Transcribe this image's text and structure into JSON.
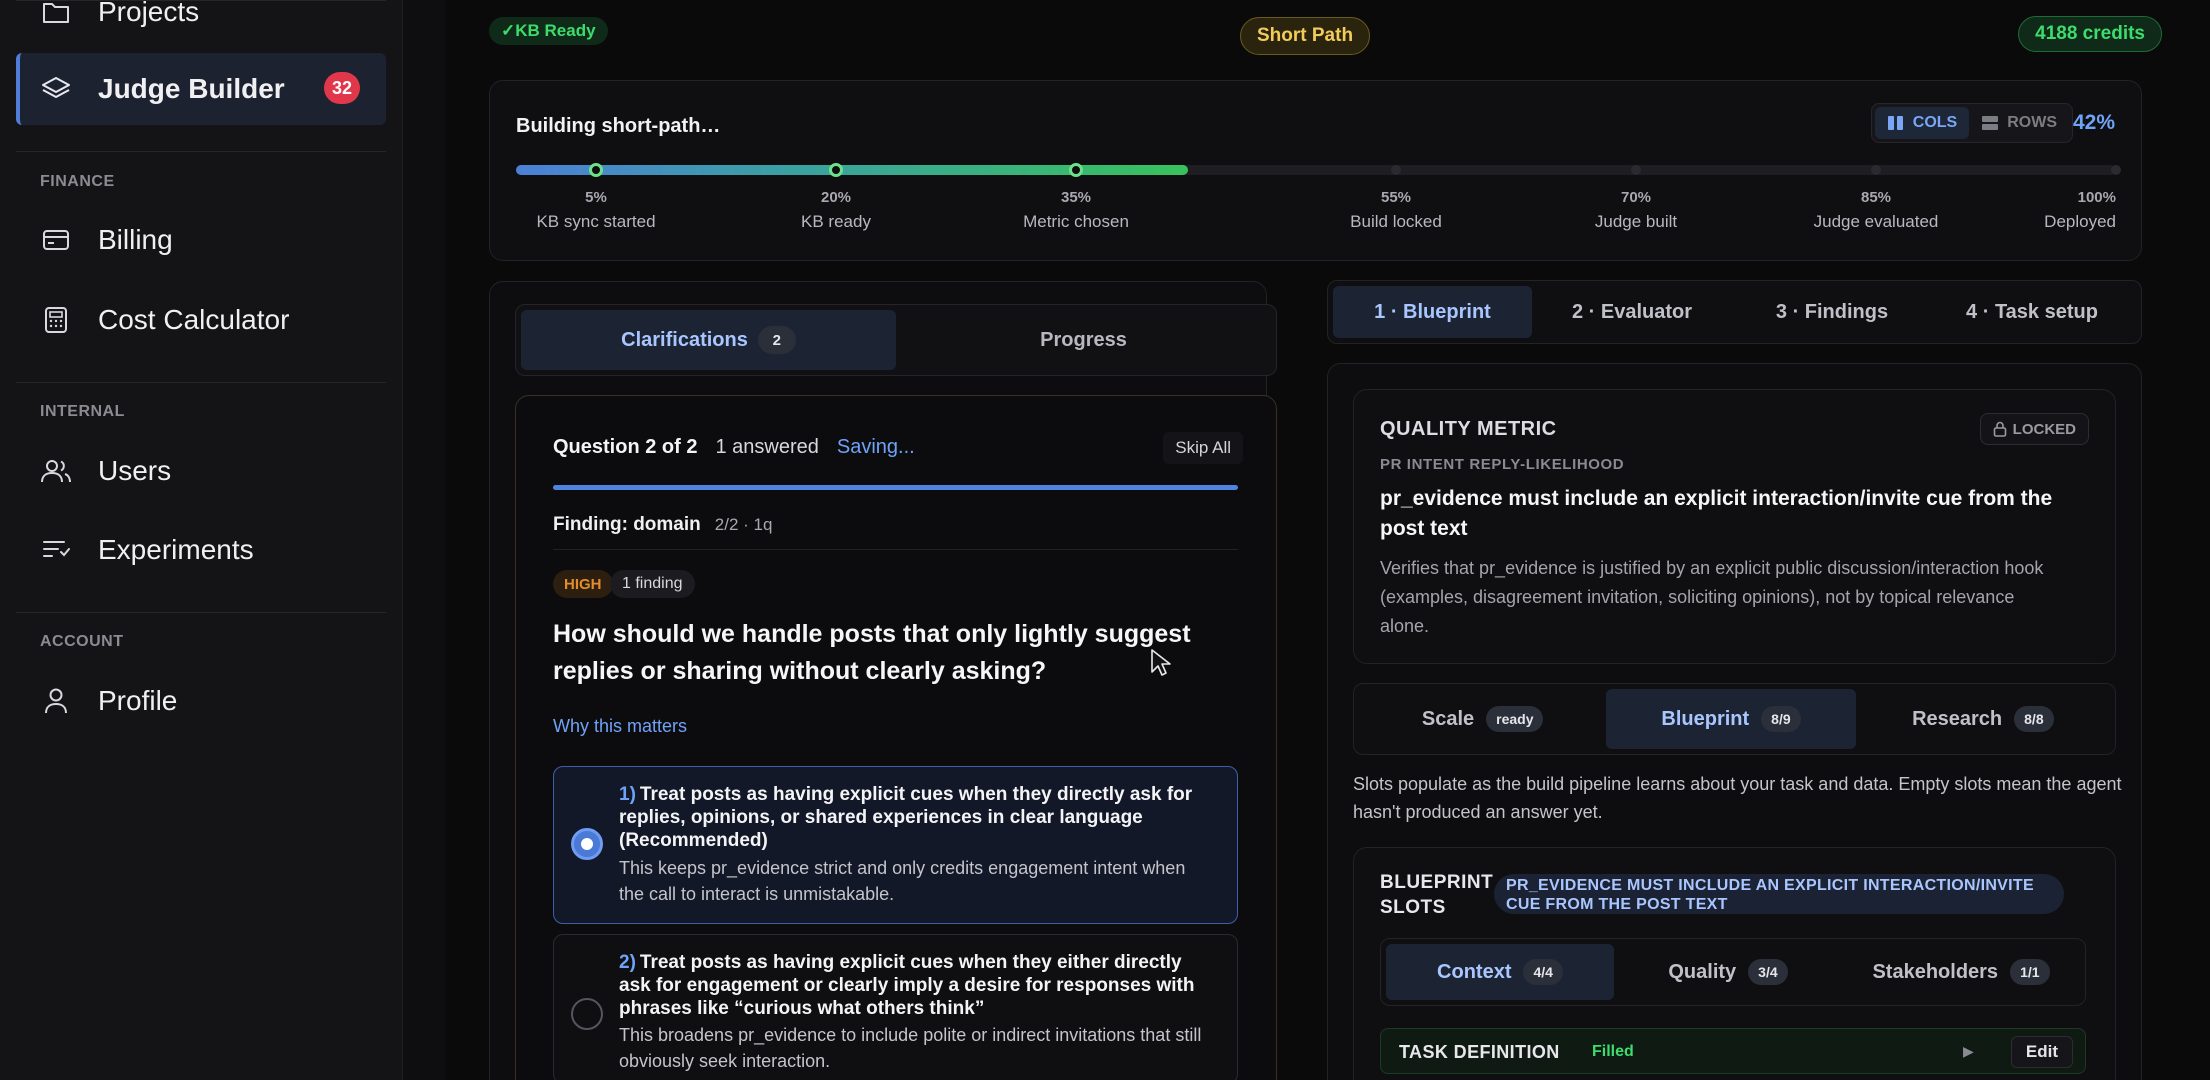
{
  "sidebar": {
    "top_item": "Projects",
    "active_item": {
      "label": "Judge Builder",
      "badge": "32"
    },
    "sections": [
      {
        "title": "FINANCE",
        "items": [
          "Billing",
          "Cost Calculator"
        ]
      },
      {
        "title": "INTERNAL",
        "items": [
          "Users",
          "Experiments"
        ]
      },
      {
        "title": "ACCOUNT",
        "items": [
          "Profile"
        ]
      }
    ]
  },
  "header": {
    "kb_status": "✓KB Ready",
    "path": "Short Path",
    "credits": "4188 credits"
  },
  "progress": {
    "title": "Building short-path…",
    "view_cols": "COLS",
    "view_rows": "ROWS",
    "percent_label": "42%",
    "fill_fraction": 0.42,
    "milestones": [
      {
        "pct": "5%",
        "name": "KB sync started",
        "done": true
      },
      {
        "pct": "20%",
        "name": "KB ready",
        "done": true
      },
      {
        "pct": "35%",
        "name": "Metric chosen",
        "done": true
      },
      {
        "pct": "55%",
        "name": "Build locked",
        "done": false
      },
      {
        "pct": "70%",
        "name": "Judge built",
        "done": false
      },
      {
        "pct": "85%",
        "name": "Judge evaluated",
        "done": false
      },
      {
        "pct": "100%",
        "name": "Deployed",
        "done": false
      }
    ]
  },
  "left": {
    "tab_clarifications": "Clarifications",
    "tab_clarifications_count": "2",
    "tab_progress": "Progress",
    "question_counter": "Question 2 of 2",
    "answered": "1 answered",
    "saving": "Saving...",
    "skip_all": "Skip All",
    "question_progress": 1.0,
    "finding_label": "Finding: domain",
    "finding_meta": "2/2 · 1q",
    "priority": "HIGH",
    "finding_count": "1 finding",
    "question": "How should we handle posts that only lightly suggest replies or sharing without clearly asking?",
    "why": "Why this matters",
    "options": [
      {
        "num": "1)",
        "title": "Treat posts as having explicit cues when they directly ask for replies, opinions, or shared experiences in clear language (Recommended)",
        "desc": "This keeps pr_evidence strict and only credits engagement intent when the call to interact is unmistakable.",
        "selected": true
      },
      {
        "num": "2)",
        "title": "Treat posts as having explicit cues when they either directly ask for engagement or clearly imply a desire for responses with phrases like “curious what others think”",
        "desc": "This broadens pr_evidence to include polite or indirect invitations that still obviously seek interaction.",
        "selected": false
      }
    ]
  },
  "right": {
    "tabs": [
      "1 · Blueprint",
      "2 · Evaluator",
      "3 · Findings",
      "4 · Task setup"
    ],
    "metric": {
      "heading": "QUALITY METRIC",
      "locked": "LOCKED",
      "sub": "PR INTENT REPLY-LIKELIHOOD",
      "name": "pr_evidence must include an explicit interaction/invite cue from the post text",
      "desc": "Verifies that pr_evidence is justified by an explicit public discussion/interaction hook (examples, disagreement invitation, soliciting opinions), not by topical relevance alone."
    },
    "sub_tabs": [
      {
        "label": "Scale",
        "count": "ready"
      },
      {
        "label": "Blueprint",
        "count": "8/9"
      },
      {
        "label": "Research",
        "count": "8/8"
      }
    ],
    "slots_note": "Slots populate as the build pipeline learns about your task and data. Empty slots mean the agent hasn't produced an answer yet.",
    "blueprint": {
      "title": "BLUEPRINT SLOTS",
      "chip": "PR_EVIDENCE MUST INCLUDE AN EXPLICIT INTERACTION/INVITE CUE FROM THE POST TEXT",
      "tabs": [
        {
          "label": "Context",
          "count": "4/4"
        },
        {
          "label": "Quality",
          "count": "3/4"
        },
        {
          "label": "Stakeholders",
          "count": "1/1"
        }
      ],
      "task_definition": "TASK DEFINITION",
      "task_status": "Filled",
      "edit": "Edit"
    }
  }
}
